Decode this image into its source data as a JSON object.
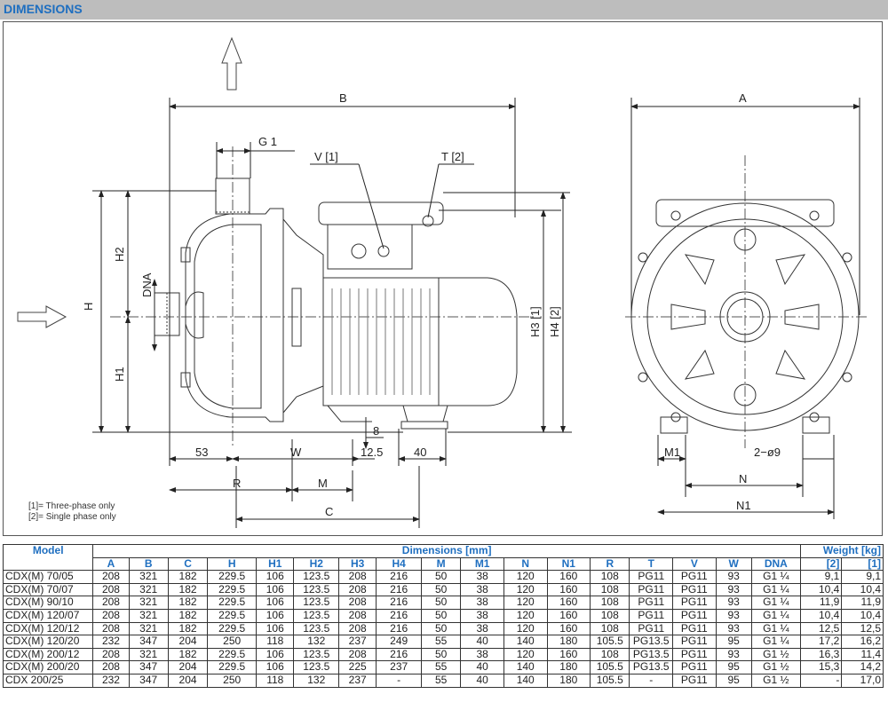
{
  "header": {
    "title": "DIMENSIONS"
  },
  "drawing": {
    "labels": {
      "B": "B",
      "A": "A",
      "G1": "G 1",
      "V1": "V [1]",
      "T2": "T [2]",
      "H": "H",
      "H1": "H1",
      "H2": "H2",
      "DNA": "DNA",
      "H3": "H3 [1]",
      "H4": "H4 [2]",
      "d53": "53",
      "W": "W",
      "d12_5": "12.5",
      "d40": "40",
      "d8": "8",
      "R": "R",
      "M": "M",
      "C": "C",
      "M1": "M1",
      "holes": "2−ø9",
      "N": "N",
      "N1": "N1"
    },
    "notes": [
      "[1]= Three-phase only",
      "[2]= Single phase only"
    ]
  },
  "table": {
    "model_header": "Model",
    "dimensions_header": "Dimensions [mm]",
    "weight_header": "Weight [kg]",
    "columns": [
      "A",
      "B",
      "C",
      "H",
      "H1",
      "H2",
      "H3",
      "H4",
      "M",
      "M1",
      "N",
      "N1",
      "R",
      "T",
      "V",
      "W",
      "DNA"
    ],
    "weight_columns": [
      "[2]",
      "[1]"
    ],
    "rows": [
      [
        "CDX(M) 70/05",
        "208",
        "321",
        "182",
        "229.5",
        "106",
        "123.5",
        "208",
        "216",
        "50",
        "38",
        "120",
        "160",
        "108",
        "PG11",
        "PG11",
        "93",
        "G1 ¼",
        "9,1",
        "9,1"
      ],
      [
        "CDX(M) 70/07",
        "208",
        "321",
        "182",
        "229.5",
        "106",
        "123.5",
        "208",
        "216",
        "50",
        "38",
        "120",
        "160",
        "108",
        "PG11",
        "PG11",
        "93",
        "G1 ¼",
        "10,4",
        "10,4"
      ],
      [
        "CDX(M) 90/10",
        "208",
        "321",
        "182",
        "229.5",
        "106",
        "123.5",
        "208",
        "216",
        "50",
        "38",
        "120",
        "160",
        "108",
        "PG11",
        "PG11",
        "93",
        "G1 ¼",
        "11,9",
        "11,9"
      ],
      [
        "CDX(M) 120/07",
        "208",
        "321",
        "182",
        "229.5",
        "106",
        "123.5",
        "208",
        "216",
        "50",
        "38",
        "120",
        "160",
        "108",
        "PG11",
        "PG11",
        "93",
        "G1 ¼",
        "10,4",
        "10,4"
      ],
      [
        "CDX(M) 120/12",
        "208",
        "321",
        "182",
        "229.5",
        "106",
        "123.5",
        "208",
        "216",
        "50",
        "38",
        "120",
        "160",
        "108",
        "PG11",
        "PG11",
        "93",
        "G1 ¼",
        "12,5",
        "12,5"
      ],
      [
        "CDX(M) 120/20",
        "232",
        "347",
        "204",
        "250",
        "118",
        "132",
        "237",
        "249",
        "55",
        "40",
        "140",
        "180",
        "105.5",
        "PG13.5",
        "PG11",
        "95",
        "G1 ¼",
        "17,2",
        "16,2"
      ],
      [
        "CDX(M) 200/12",
        "208",
        "321",
        "182",
        "229.5",
        "106",
        "123.5",
        "208",
        "216",
        "50",
        "38",
        "120",
        "160",
        "108",
        "PG13.5",
        "PG11",
        "93",
        "G1 ½",
        "16,3",
        "11,4"
      ],
      [
        "CDX(M) 200/20",
        "208",
        "347",
        "204",
        "229.5",
        "106",
        "123.5",
        "225",
        "237",
        "55",
        "40",
        "140",
        "180",
        "105.5",
        "PG13.5",
        "PG11",
        "95",
        "G1 ½",
        "15,3",
        "14,2"
      ],
      [
        "CDX 200/25",
        "232",
        "347",
        "204",
        "250",
        "118",
        "132",
        "237",
        "-",
        "55",
        "40",
        "140",
        "180",
        "105.5",
        "-",
        "PG11",
        "95",
        "G1 ½",
        "-",
        "17,0"
      ]
    ]
  }
}
